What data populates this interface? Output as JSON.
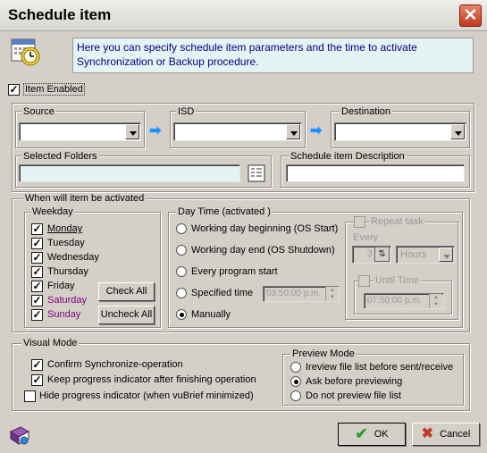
{
  "window": {
    "title": "Schedule item",
    "close": "✕"
  },
  "info": {
    "text": "Here you can specify schedule item parameters and the time to activate Synchronization or Backup procedure."
  },
  "item_enabled": {
    "label": "Item Enabled",
    "checked": true
  },
  "source": {
    "label": "Source"
  },
  "isd": {
    "label": "ISD"
  },
  "destination": {
    "label": "Destination"
  },
  "selected_folders": {
    "label": "Selected Folders"
  },
  "description": {
    "label": "Schedule item Description"
  },
  "activation": {
    "label": "When will item be activated"
  },
  "weekday": {
    "label": "Weekday",
    "days": [
      {
        "label": "Monday",
        "checked": true
      },
      {
        "label": "Tuesday",
        "checked": true
      },
      {
        "label": "Wednesday",
        "checked": true
      },
      {
        "label": "Thursday",
        "checked": true
      },
      {
        "label": "Friday",
        "checked": true
      },
      {
        "label": "Saturday",
        "checked": true
      },
      {
        "label": "Sunday",
        "checked": true
      }
    ],
    "check_all": "Check All",
    "uncheck_all": "Uncheck All"
  },
  "daytime": {
    "label": "Day Time (activated )",
    "options": [
      {
        "label": "Working day beginning (OS Start)",
        "selected": false
      },
      {
        "label": "Working day end (OS Shutdown)",
        "selected": false
      },
      {
        "label": "Every program start",
        "selected": false
      },
      {
        "label": "Specified time",
        "selected": false
      },
      {
        "label": "Manually",
        "selected": true
      }
    ],
    "specified_time_value": "03:50:00 p.m."
  },
  "repeat": {
    "label": "Repeat task",
    "every_label": "Every",
    "every_value": "3",
    "unit": "Hours",
    "until_label": "Until Time",
    "until_value": "07:50:00 p.m."
  },
  "visual": {
    "label": "Visual Mode",
    "options": [
      {
        "label": "Confirm Synchronize-operation",
        "checked": true
      },
      {
        "label": "Keep progress indicator after finishing operation",
        "checked": true
      },
      {
        "label": "Hide progress indicator (when vuBrief minimized)",
        "checked": false
      }
    ]
  },
  "preview": {
    "label": "Preview Mode",
    "options": [
      {
        "label": "Ireview file list before sent/receive",
        "selected": false
      },
      {
        "label": "Ask before previewing",
        "selected": true
      },
      {
        "label": "Do not preview file list",
        "selected": false
      }
    ]
  },
  "buttons": {
    "ok": "OK",
    "cancel": "Cancel"
  }
}
